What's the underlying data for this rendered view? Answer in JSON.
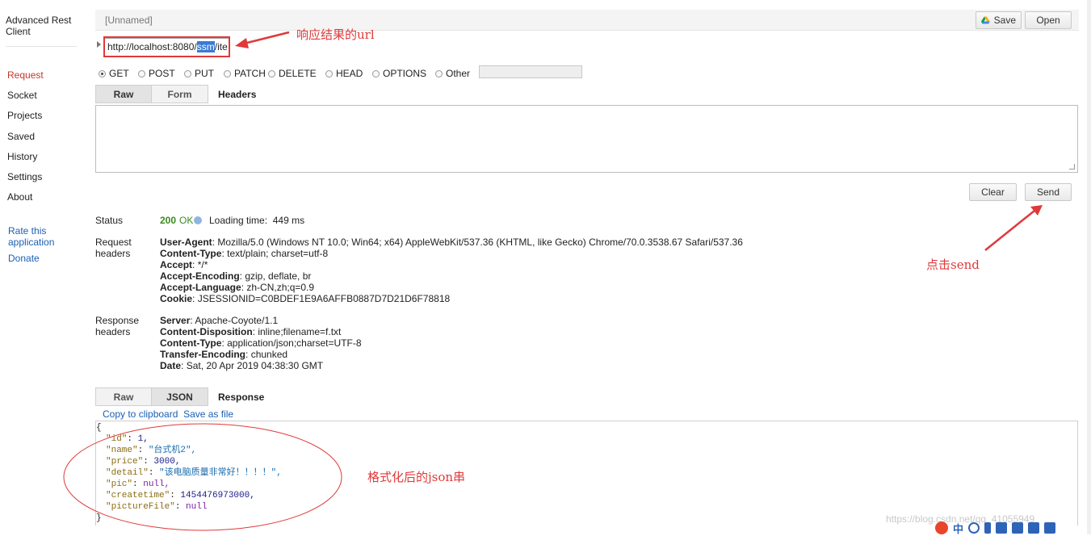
{
  "sidebar": {
    "app_name": "Advanced Rest Client",
    "items": [
      {
        "label": "Request",
        "active": true
      },
      {
        "label": "Socket"
      },
      {
        "label": "Projects"
      },
      {
        "label": "Saved"
      },
      {
        "label": "History"
      },
      {
        "label": "Settings"
      },
      {
        "label": "About"
      }
    ],
    "links": [
      "Rate this application",
      "Donate"
    ]
  },
  "toolbar": {
    "title": "[Unnamed]",
    "save_label": "Save",
    "open_label": "Open"
  },
  "request": {
    "url_prefix": "http://localhost:8080/",
    "url_selected": "ssm",
    "url_suffix": "/ite",
    "methods": [
      "GET",
      "POST",
      "PUT",
      "PATCH",
      "DELETE",
      "HEAD",
      "OPTIONS",
      "Other"
    ],
    "selected_method": "GET",
    "tabs": [
      "Raw",
      "Form"
    ],
    "tab_title": "Headers",
    "clear_label": "Clear",
    "send_label": "Send"
  },
  "status": {
    "label": "Status",
    "code": "200",
    "text": "OK",
    "loading_label": "Loading time:",
    "loading_value": "449 ms"
  },
  "request_headers": {
    "label": "Request headers",
    "items": [
      {
        "name": "User-Agent",
        "value": "Mozilla/5.0 (Windows NT 10.0; Win64; x64) AppleWebKit/537.36 (KHTML, like Gecko) Chrome/70.0.3538.67 Safari/537.36"
      },
      {
        "name": "Content-Type",
        "value": "text/plain; charset=utf-8"
      },
      {
        "name": "Accept",
        "value": "*/*"
      },
      {
        "name": "Accept-Encoding",
        "value": "gzip, deflate, br"
      },
      {
        "name": "Accept-Language",
        "value": "zh-CN,zh;q=0.9"
      },
      {
        "name": "Cookie",
        "value": "JSESSIONID=C0BDEF1E9A6AFFB0887D7D21D6F78818"
      }
    ]
  },
  "response_headers": {
    "label": "Response headers",
    "items": [
      {
        "name": "Server",
        "value": "Apache-Coyote/1.1"
      },
      {
        "name": "Content-Disposition",
        "value": "inline;filename=f.txt"
      },
      {
        "name": "Content-Type",
        "value": "application/json;charset=UTF-8"
      },
      {
        "name": "Transfer-Encoding",
        "value": "chunked"
      },
      {
        "name": "Date",
        "value": "Sat, 20 Apr 2019 04:38:30 GMT"
      }
    ]
  },
  "response": {
    "tabs": [
      "Raw",
      "JSON"
    ],
    "tab_title": "Response",
    "copy_label": "Copy to clipboard",
    "save_label": "Save as file",
    "open_brace": "{",
    "close_brace": "}",
    "fields": [
      {
        "key": "\"id\"",
        "value": "1,",
        "type": "number"
      },
      {
        "key": "\"name\"",
        "value": "\"台式机2\",",
        "type": "string"
      },
      {
        "key": "\"price\"",
        "value": "3000,",
        "type": "number"
      },
      {
        "key": "\"detail\"",
        "value": "\"该电脑质量非常好！！！！\",",
        "type": "string"
      },
      {
        "key": "\"pic\"",
        "value": "null,",
        "type": "null"
      },
      {
        "key": "\"createtime\"",
        "value": "1454476973000,",
        "type": "number"
      },
      {
        "key": "\"pictureFile\"",
        "value": "null",
        "type": "null"
      }
    ]
  },
  "annotations": {
    "url_note": "响应结果的url",
    "send_note": "点击send",
    "json_note": "格式化后的json串",
    "color": "#e0393a"
  },
  "watermark": "https://blog.csdn.net/qq_41055949",
  "tray": {
    "ime": "中"
  }
}
